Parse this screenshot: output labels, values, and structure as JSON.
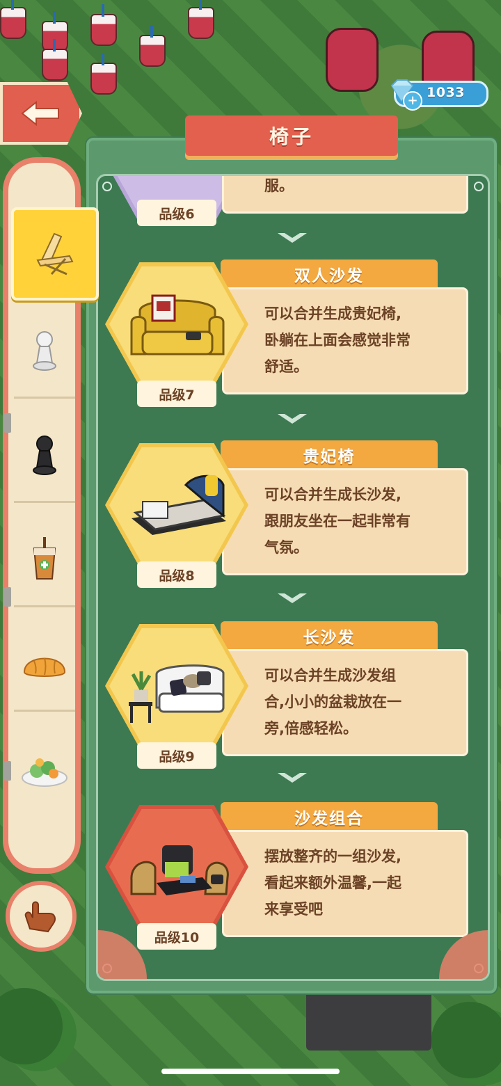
{
  "header": {
    "title": "椅子"
  },
  "currency": {
    "value": "1033",
    "icon": "diamond-icon"
  },
  "sidebar": {
    "items": [
      {
        "icon": "folding-chair-icon",
        "active": true
      },
      {
        "icon": "white-pawn-icon",
        "active": false
      },
      {
        "icon": "black-pawn-icon",
        "active": false
      },
      {
        "icon": "bubble-tea-icon",
        "active": false
      },
      {
        "icon": "bread-icon",
        "active": false
      },
      {
        "icon": "salad-plate-icon",
        "active": false
      }
    ],
    "hand_button_icon": "pointing-hand-icon"
  },
  "partial_entry": {
    "text_tail": "服。",
    "grade": "品级6"
  },
  "entries": [
    {
      "name": "双人沙发",
      "desc_lines": [
        "可以合并生成贵妃椅,",
        "卧躺在上面会感觉非常",
        "舒适。"
      ],
      "grade": "品级7",
      "icon": "loveseat-icon"
    },
    {
      "name": "贵妃椅",
      "desc_lines": [
        "可以合并生成长沙发,",
        "跟朋友坐在一起非常有",
        "气氛。"
      ],
      "grade": "品级8",
      "icon": "chaise-lounge-icon"
    },
    {
      "name": "长沙发",
      "desc_lines": [
        "可以合并生成沙发组",
        "合,小小的盆栽放在一",
        "旁,倍感轻松。"
      ],
      "grade": "品级9",
      "icon": "long-sofa-icon"
    },
    {
      "name": "沙发组合",
      "desc_lines": [
        "摆放整齐的一组沙发,",
        "看起来额外温馨,一起",
        "来享受吧"
      ],
      "grade": "品级10",
      "icon": "sofa-set-icon"
    }
  ],
  "colors": {
    "accent": "#e4604e",
    "panel_green": "#3d7a52",
    "tab_orange": "#f3a840",
    "desc_bg": "#f6dcb4"
  }
}
